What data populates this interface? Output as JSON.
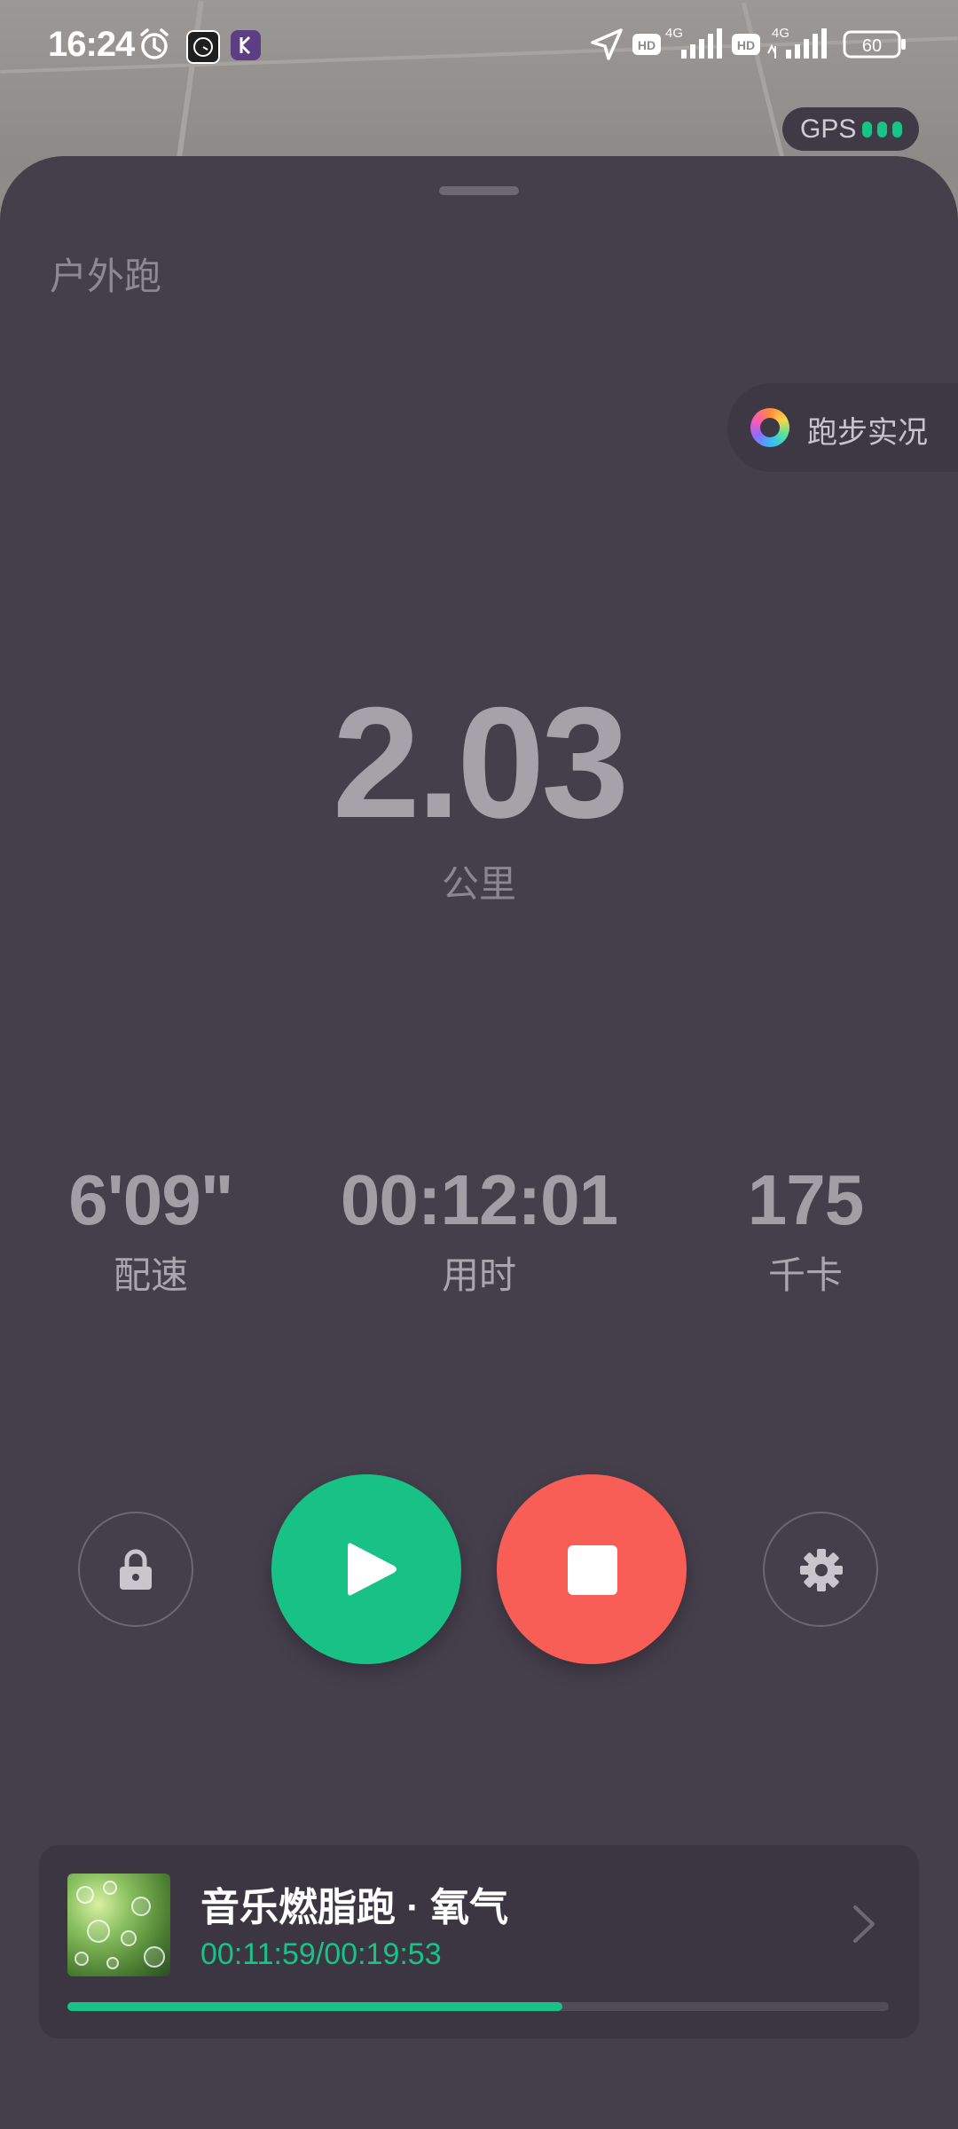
{
  "status_bar": {
    "time": "16:24",
    "icons": [
      "alarm-icon",
      "app-badge-clock",
      "app-badge-k",
      "location-arrow-icon",
      "hd-icon",
      "signal-4g-icon",
      "hd-icon",
      "signal-4g-icon"
    ],
    "battery": "60"
  },
  "gps": {
    "label": "GPS",
    "signal_bars": 3,
    "color": "#19c286"
  },
  "run_type": "户外跑",
  "live_button": {
    "label": "跑步实况"
  },
  "distance": {
    "value": "2.03",
    "unit": "公里"
  },
  "stats": [
    {
      "value": "6'09\"",
      "label": "配速"
    },
    {
      "value": "00:12:01",
      "label": "用时"
    },
    {
      "value": "175",
      "label": "千卡"
    }
  ],
  "controls": {
    "lock": "lock-icon",
    "resume": "play-icon",
    "stop": "stop-icon",
    "settings": "gear-icon",
    "resume_color": "#18c185",
    "stop_color": "#f85d56"
  },
  "music": {
    "title": "音乐燃脂跑 · 氧气",
    "time": "00:11:59/00:19:53",
    "progress": 0.603
  }
}
